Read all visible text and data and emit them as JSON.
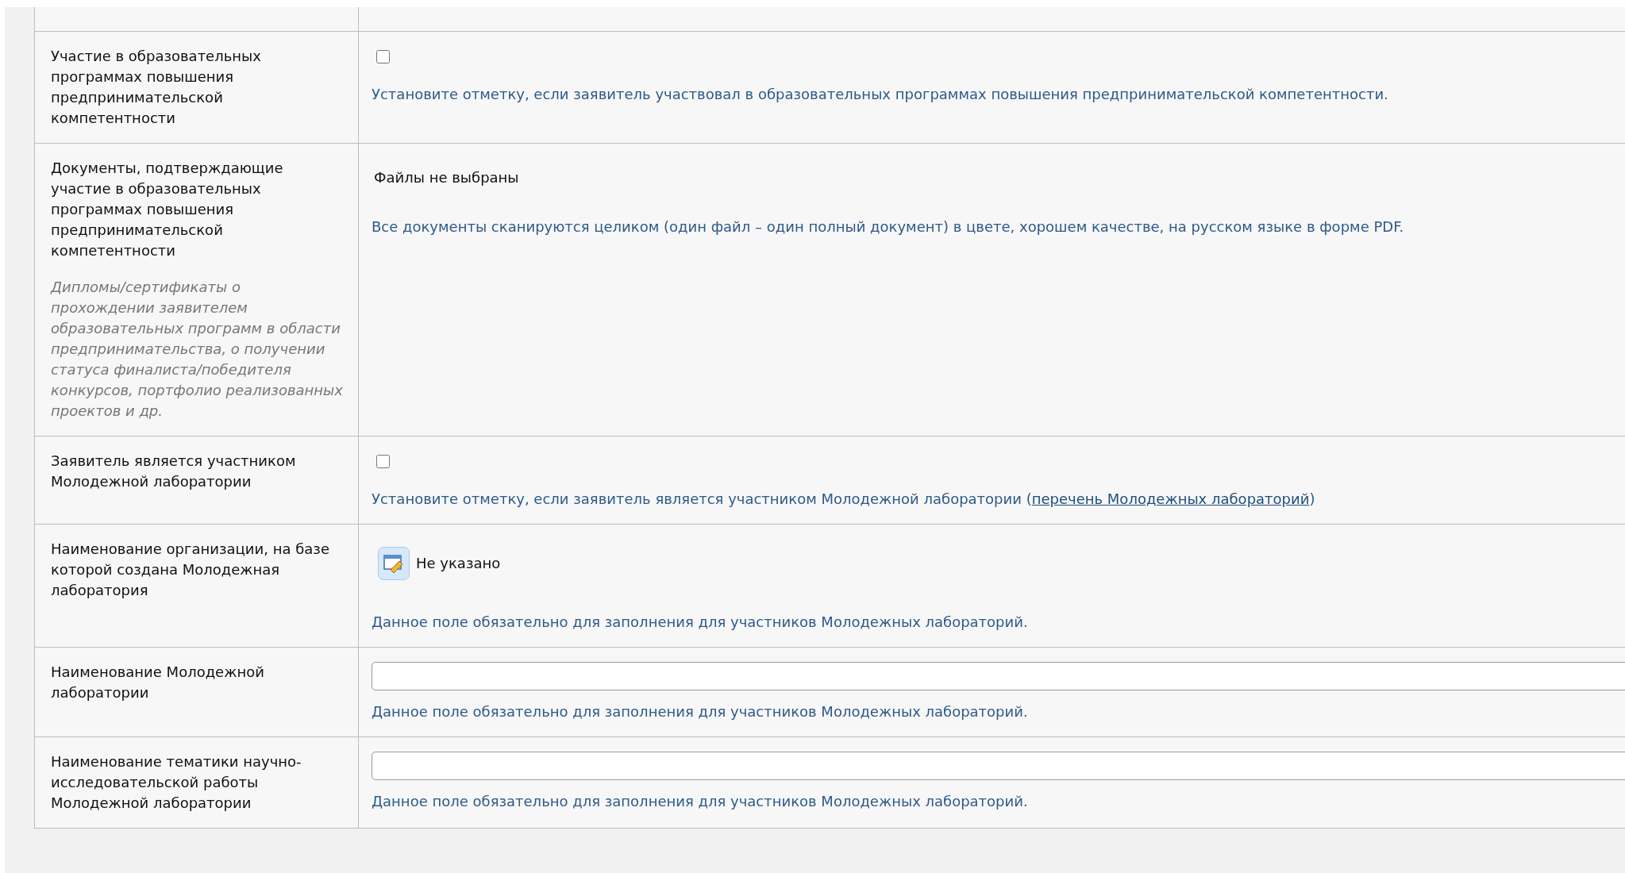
{
  "rows": [
    {
      "kind": "checkbox",
      "label": "Участие в образовательных программах повышения предпринимательской компетентности",
      "checked": false,
      "hint": "Установите отметку, если заявитель участвовал в образовательных программах повышения предпринимательской компетентности."
    },
    {
      "kind": "file",
      "label": "Документы, подтверждающие участие в образовательных программах повышения предпринимательской компетентности",
      "note": "Дипломы/сертификаты о прохождении заявителем образовательных программ в области предпринимательства, о получении статуса финалиста/победителя конкурсов, портфолио реализованных проектов и др.",
      "value": "Файлы не выбраны",
      "hint": "Все документы сканируются целиком (один файл – один полный документ) в цвете, хорошем качестве, на русском языке в форме PDF."
    },
    {
      "kind": "checkbox",
      "label": "Заявитель является участником Молодежной лаборатории",
      "checked": false,
      "hint": "Установите отметку, если заявитель является участником Молодежной лаборатории (",
      "link": "перечень Молодежных лабораторий",
      "hint_after": ")"
    },
    {
      "kind": "picker",
      "label": "Наименование организации, на базе которой создана Молодежная лаборатория",
      "value": "Не указано",
      "hint": "Данное поле обязательно для заполнения для участников Молодежных лабораторий."
    },
    {
      "kind": "text",
      "label": "Наименование Молодежной лаборатории",
      "hint": "Данное поле обязательно для заполнения для участников Молодежных лабораторий."
    },
    {
      "kind": "text",
      "label": "Наименование тематики научно-исследовательской работы Молодежной лаборатории",
      "hint": "Данное поле обязательно для заполнения для участников Молодежных лабораторий."
    }
  ]
}
